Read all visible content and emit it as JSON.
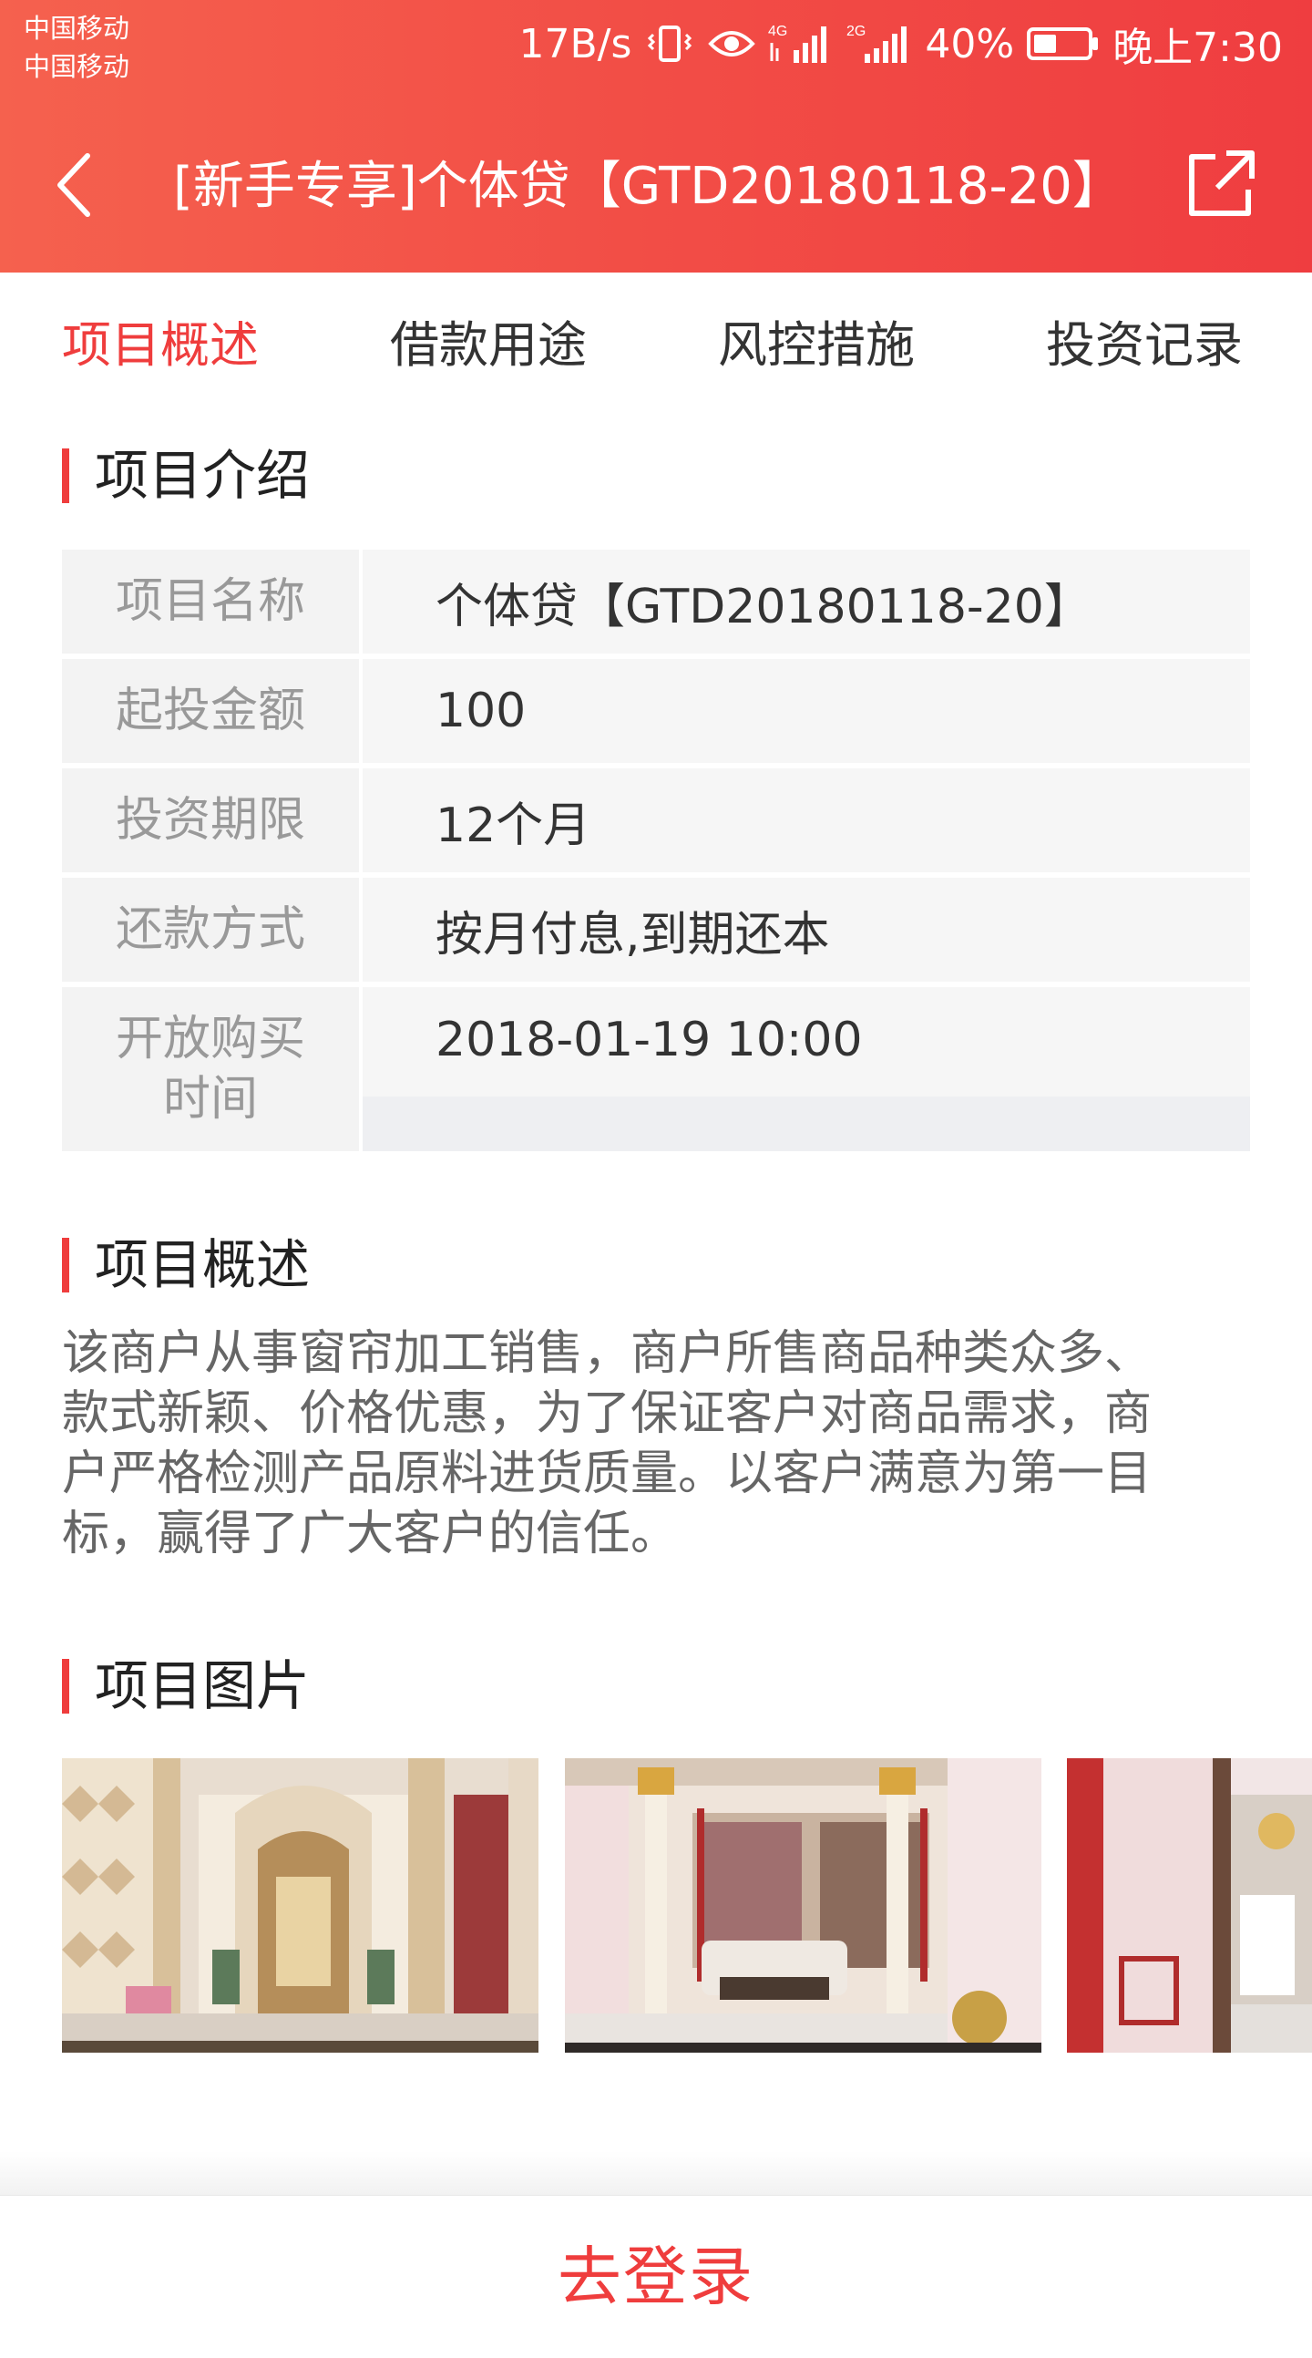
{
  "status_bar": {
    "carrier_1": "中国移动",
    "carrier_2": "中国移动",
    "speed": "17B/s",
    "signal_1": "4G",
    "signal_2": "2G",
    "battery": "40%",
    "time": "晚上7:30"
  },
  "nav": {
    "title": "[新手专享]个体贷【GTD20180118-20】",
    "back_icon": "chevron-left-icon",
    "share_icon": "share-external-icon"
  },
  "tabs": [
    {
      "label": "项目概述",
      "active": true
    },
    {
      "label": "借款用途",
      "active": false
    },
    {
      "label": "风控措施",
      "active": false
    },
    {
      "label": "投资记录",
      "active": false
    }
  ],
  "intro": {
    "title": "项目介绍",
    "rows": [
      {
        "label": "项目名称",
        "value": "个体贷【GTD20180118-20】"
      },
      {
        "label": "起投金额",
        "value": "100"
      },
      {
        "label": "投资期限",
        "value": "12个月"
      },
      {
        "label": "还款方式",
        "value": "按月付息,到期还本"
      },
      {
        "label": "开放购买时间",
        "value": "2018-01-19 10:00"
      }
    ]
  },
  "overview": {
    "title": "项目概述",
    "lines": [
      "该商户从事窗帘加工销售，商户所售商品种类众多、",
      "款式新颖、价格优惠，为了保证客户对商品需求，商",
      "户严格检测产品原料进货质量。以客户满意为第一目",
      "标，赢得了广大客户的信任。"
    ]
  },
  "photos": {
    "title": "项目图片",
    "items": [
      "photo-1",
      "photo-2",
      "photo-3"
    ]
  },
  "bottom": {
    "login_label": "去登录"
  },
  "colors": {
    "accent": "#ef3d3d",
    "header_start": "#f5614e",
    "header_end": "#ef3d40"
  }
}
